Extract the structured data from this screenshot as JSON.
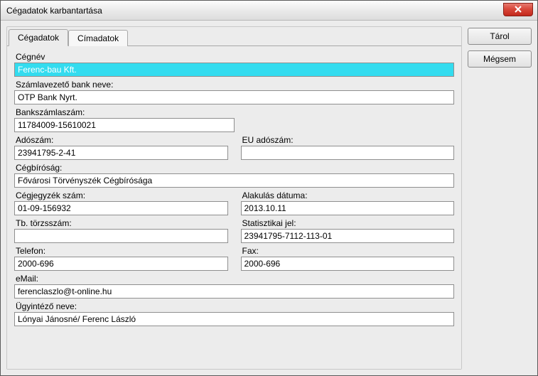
{
  "window": {
    "title": "Cégadatok karbantartása"
  },
  "tabs": [
    {
      "label": "Cégadatok",
      "active": true
    },
    {
      "label": "Címadatok",
      "active": false
    }
  ],
  "buttons": {
    "save": "Tárol",
    "cancel": "Mégsem"
  },
  "form": {
    "cegnev_label": "Cégnév",
    "cegnev": "Ferenc-bau Kft.",
    "bank_neve_label": "Számlavezető bank neve:",
    "bank_neve": "OTP Bank Nyrt.",
    "bankszamla_label": "Bankszámlaszám:",
    "bankszamla": "11784009-15610021",
    "adoszam_label": "Adószám:",
    "adoszam": "23941795-2-41",
    "eu_adoszam_label": "EU adószám:",
    "eu_adoszam": "",
    "cegbirosag_label": "Cégbíróság:",
    "cegbirosag": "Fővárosi Törvényszék Cégbírósága",
    "cegjegyzek_label": "Cégjegyzék szám:",
    "cegjegyzek": "01-09-156932",
    "alak_datum_label": "Alakulás dátuma:",
    "alak_datum": "2013.10.11",
    "tb_torzsszam_label": "Tb. törzsszám:",
    "tb_torzsszam": "",
    "stat_jel_label": "Statisztikai jel:",
    "stat_jel": "23941795-7112-113-01",
    "telefon_label": "Telefon:",
    "telefon": "2000-696",
    "fax_label": "Fax:",
    "fax": "2000-696",
    "email_label": "eMail:",
    "email": "ferenclaszlo@t-online.hu",
    "ugyintezo_label": "Ügyintéző neve:",
    "ugyintezo": "Lónyai Jánosné/ Ferenc László"
  }
}
